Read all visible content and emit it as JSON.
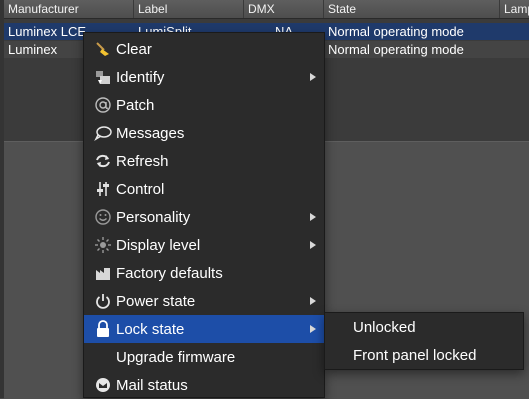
{
  "table": {
    "columns": [
      "Manufacturer",
      "Label",
      "DMX",
      "State",
      "Lamp"
    ],
    "rows": [
      {
        "manufacturer": "Luminex LCE",
        "label": "LumiSplit",
        "dmx": "NA",
        "state": "Normal operating mode"
      },
      {
        "manufacturer": "Luminex",
        "label": "",
        "dmx": "",
        "state": "Normal operating mode"
      }
    ]
  },
  "context_menu": {
    "items": [
      {
        "label": "Clear",
        "icon": "broom-icon"
      },
      {
        "label": "Identify",
        "icon": "identify-icon",
        "submenu": true
      },
      {
        "label": "Patch",
        "icon": "at-sign-icon"
      },
      {
        "label": "Messages",
        "icon": "speech-bubble-icon"
      },
      {
        "label": "Refresh",
        "icon": "refresh-icon"
      },
      {
        "label": "Control",
        "icon": "control-icon"
      },
      {
        "label": "Personality",
        "icon": "smiley-icon",
        "submenu": true
      },
      {
        "label": "Display level",
        "icon": "brightness-icon",
        "submenu": true
      },
      {
        "label": "Factory defaults",
        "icon": "factory-icon"
      },
      {
        "label": "Power state",
        "icon": "power-icon",
        "submenu": true
      },
      {
        "label": "Lock state",
        "icon": "lock-icon",
        "submenu": true,
        "active": true
      },
      {
        "label": "Upgrade firmware",
        "icon": ""
      },
      {
        "label": "Mail status",
        "icon": "mail-icon"
      }
    ]
  },
  "lock_submenu": {
    "items": [
      "Unlocked",
      "Front panel locked"
    ]
  },
  "colors": {
    "selection": "#1d4ea8",
    "menu_background": "#2b2b2b",
    "selected_row": "#1f3a6b"
  }
}
